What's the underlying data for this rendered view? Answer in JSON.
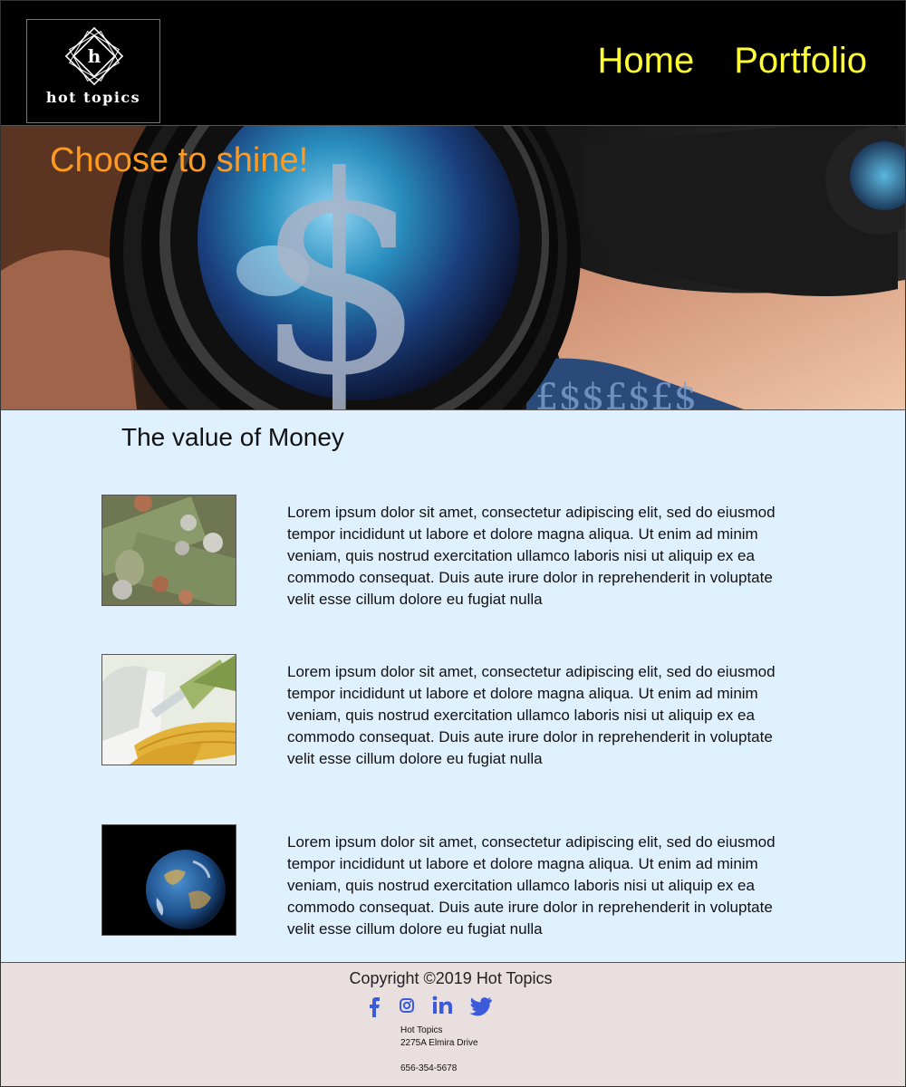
{
  "header": {
    "logo_letter": "h",
    "logo_text": "hot topics",
    "nav": [
      "Home",
      "Portfolio"
    ]
  },
  "hero": {
    "title": "Choose to shine!"
  },
  "main": {
    "heading": "The value of Money",
    "articles": [
      {
        "image": "money-and-coins-image",
        "text": "Lorem ipsum dolor sit amet, consectetur adipiscing elit, sed do eiusmod tempor incididunt ut labore et dolore magna aliqua. Ut enim ad minim veniam, quis nostrud exercitation ullamco laboris nisi ut aliquip ex ea commodo consequat. Duis aute irure dolor in reprehenderit in voluptate velit esse cillum dolore eu fugiat nulla"
      },
      {
        "image": "corn-syringe-image",
        "text": "Lorem ipsum dolor sit amet, consectetur adipiscing elit, sed do eiusmod tempor incididunt ut labore et dolore magna aliqua. Ut enim ad minim veniam, quis nostrud exercitation ullamco laboris nisi ut aliquip ex ea commodo consequat. Duis aute irure dolor in reprehenderit in voluptate velit esse cillum dolore eu fugiat nulla"
      },
      {
        "image": "earth-globe-image",
        "text": "Lorem ipsum dolor sit amet, consectetur adipiscing elit, sed do eiusmod tempor incididunt ut labore et dolore magna aliqua. Ut enim ad minim veniam, quis nostrud exercitation ullamco laboris nisi ut aliquip ex ea commodo consequat. Duis aute irure dolor in reprehenderit in voluptate velit esse cillum dolore eu fugiat nulla"
      }
    ]
  },
  "footer": {
    "copyright": "Copyright ©2019 Hot Topics",
    "social_icons": [
      "facebook-icon",
      "instagram-icon",
      "linkedin-icon",
      "twitter-icon"
    ],
    "social_color": "#3b5bdb",
    "contact": {
      "name": "Hot Topics",
      "address": "2275A Elmira Drive",
      "phone": "656-354-5678"
    }
  },
  "colors": {
    "header_bg": "#000000",
    "nav": "#ffff33",
    "hero_title": "#ff9a1f",
    "content_bg": "#dff1ff",
    "footer_bg": "#e8dfde"
  }
}
